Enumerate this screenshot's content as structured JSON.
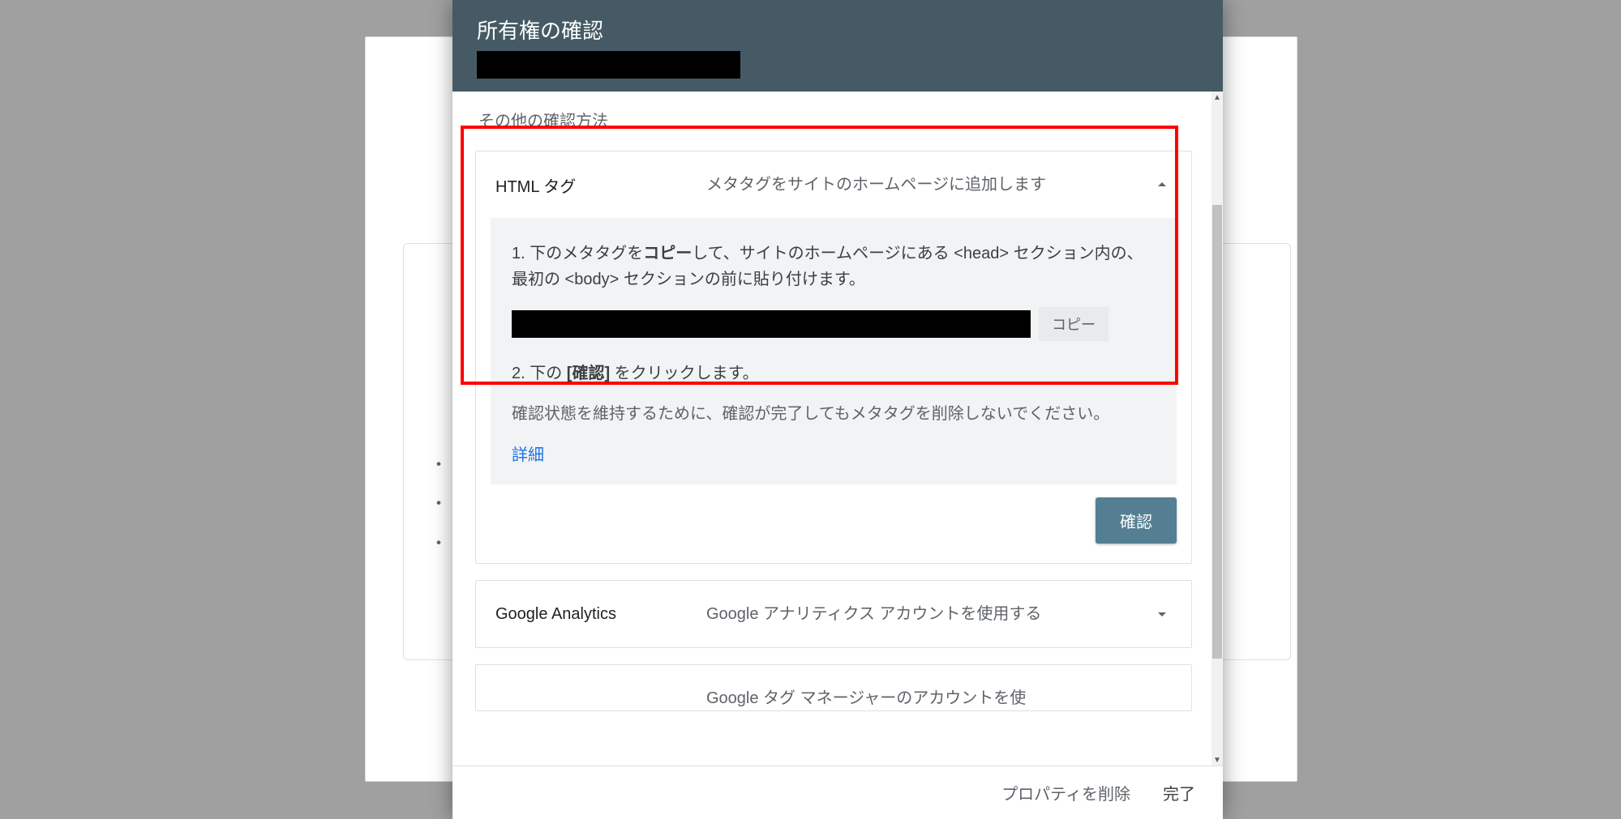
{
  "modal": {
    "title": "所有権の確認",
    "section_label": "その他の確認方法",
    "html_tag": {
      "name": "HTML タグ",
      "desc": "メタタグをサイトのホームページに追加します",
      "step1_prefix": "1. 下のメタタグを",
      "step1_bold": "コピー",
      "step1_suffix": "して、サイトのホームページにある <head> セクション内の、最初の <body> セクションの前に貼り付けます。",
      "copy_btn": "コピー",
      "step2_prefix": "2. 下の ",
      "step2_bold": "[確認]",
      "step2_suffix": " をクリックします。",
      "note": "確認状態を維持するために、確認が完了してもメタタグを削除しないでください。",
      "detail_link": "詳細",
      "confirm_btn": "確認"
    },
    "ga": {
      "name": "Google Analytics",
      "desc": "Google アナリティクス アカウントを使用する"
    },
    "gtm": {
      "desc_partial": "Google タグ マネージャーのアカウントを使"
    },
    "footer": {
      "remove": "プロパティを削除",
      "done": "完了"
    }
  },
  "bg": {
    "bullet": "・"
  }
}
